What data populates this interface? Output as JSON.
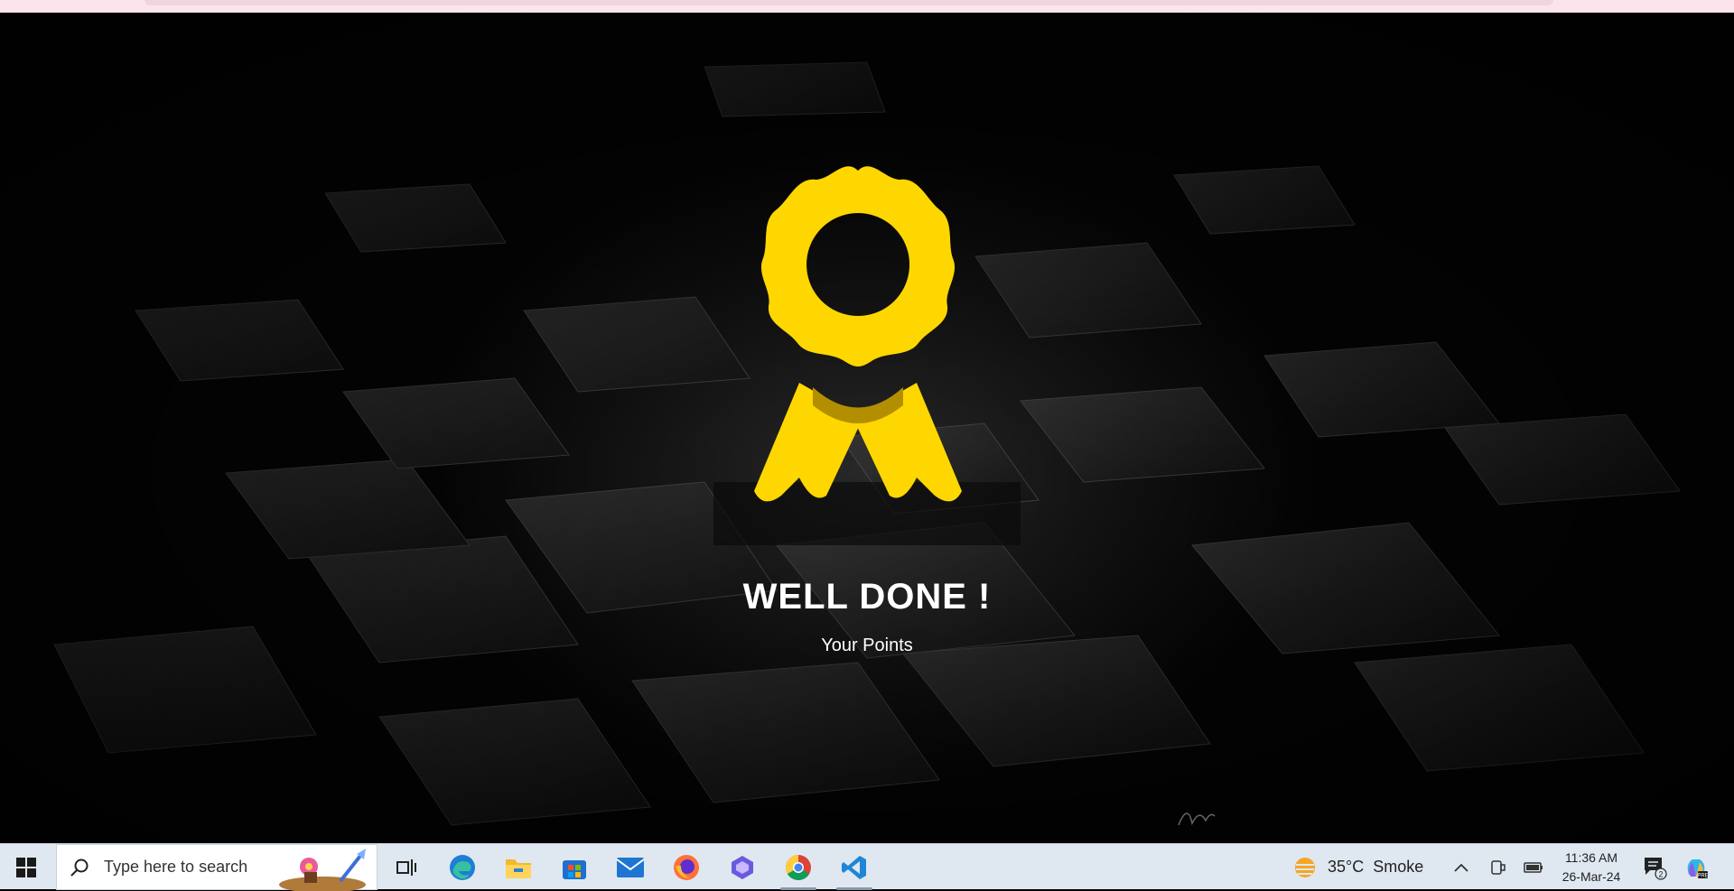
{
  "page": {
    "title": "WELL DONE !",
    "subtitle": "Your Points"
  },
  "colors": {
    "badge": "#FFD700",
    "badge_shadow": "#B38F00",
    "text": "#FFFFFF",
    "background": "#050505",
    "taskbar": "#DFE8F1"
  },
  "taskbar": {
    "start_icon": "windows-start-icon",
    "search_placeholder": "Type here to search",
    "search_icon": "search-icon",
    "apps": [
      {
        "name": "task-view-icon"
      },
      {
        "name": "edge-browser-icon"
      },
      {
        "name": "file-explorer-icon"
      },
      {
        "name": "microsoft-store-icon"
      },
      {
        "name": "mail-icon"
      },
      {
        "name": "firefox-icon"
      },
      {
        "name": "copilot-app-icon"
      },
      {
        "name": "chrome-icon",
        "active": true
      },
      {
        "name": "vscode-icon",
        "active": true
      }
    ],
    "weather": {
      "temp": "35°C",
      "condition": "Smoke"
    },
    "clock": {
      "time": "11:36 AM",
      "date": "26-Mar-24"
    },
    "notifications": {
      "count": "2"
    }
  }
}
